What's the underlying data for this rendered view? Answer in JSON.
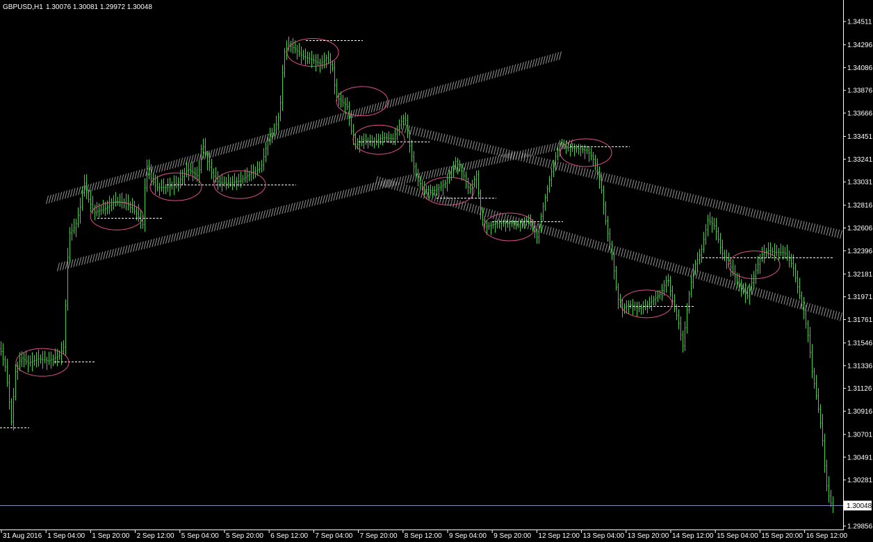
{
  "header": {
    "symbol": "GBPUSD,H1",
    "ohlc": "1.30076 1.30081 1.29972 1.30048"
  },
  "colors": {
    "background": "#000000",
    "candle": "#3fd43f",
    "axis": "#ffffff",
    "channel": "#b0b0b0",
    "ellipse": "#e0508a",
    "dashed_level": "#ffffff",
    "price_line": "#8090c0"
  },
  "chart_data": {
    "type": "line",
    "symbol": "GBPUSD",
    "timeframe": "H1",
    "current_price": "1.30048",
    "ylim": [
      1.29856,
      1.34511
    ],
    "y_ticks": [
      "1.34511",
      "1.34296",
      "1.34086",
      "1.33876",
      "1.33666",
      "1.33451",
      "1.33241",
      "1.33031",
      "1.32816",
      "1.32606",
      "1.32396",
      "1.32181",
      "1.31971",
      "1.31761",
      "1.31546",
      "1.31336",
      "1.31126",
      "1.30916",
      "1.30701",
      "1.30491",
      "1.30281",
      "1.29856"
    ],
    "x_ticks": [
      "31 Aug 2016",
      "1 Sep 04:00",
      "1 Sep 20:00",
      "2 Sep 12:00",
      "5 Sep 04:00",
      "5 Sep 20:00",
      "6 Sep 12:00",
      "7 Sep 04:00",
      "7 Sep 20:00",
      "8 Sep 12:00",
      "9 Sep 04:00",
      "9 Sep 20:00",
      "12 Sep 12:00",
      "13 Sep 04:00",
      "13 Sep 20:00",
      "14 Sep 12:00",
      "15 Sep 04:00",
      "15 Sep 20:00",
      "16 Sep 12:00"
    ],
    "price_path": [
      [
        0,
        1.3149
      ],
      [
        8,
        1.313
      ],
      [
        16,
        1.3082
      ],
      [
        22,
        1.3128
      ],
      [
        30,
        1.3141
      ],
      [
        40,
        1.3136
      ],
      [
        55,
        1.314
      ],
      [
        70,
        1.3138
      ],
      [
        85,
        1.3143
      ],
      [
        92,
        1.3152
      ],
      [
        96,
        1.3226
      ],
      [
        100,
        1.3256
      ],
      [
        108,
        1.3262
      ],
      [
        115,
        1.328
      ],
      [
        120,
        1.3305
      ],
      [
        125,
        1.329
      ],
      [
        135,
        1.3275
      ],
      [
        150,
        1.3278
      ],
      [
        165,
        1.3285
      ],
      [
        180,
        1.3284
      ],
      [
        195,
        1.3275
      ],
      [
        205,
        1.3264
      ],
      [
        210,
        1.332
      ],
      [
        215,
        1.3308
      ],
      [
        225,
        1.3298
      ],
      [
        240,
        1.3298
      ],
      [
        255,
        1.3302
      ],
      [
        270,
        1.3315
      ],
      [
        285,
        1.3308
      ],
      [
        290,
        1.334
      ],
      [
        298,
        1.3322
      ],
      [
        305,
        1.331
      ],
      [
        315,
        1.3302
      ],
      [
        330,
        1.3302
      ],
      [
        345,
        1.3304
      ],
      [
        360,
        1.3311
      ],
      [
        375,
        1.3316
      ],
      [
        385,
        1.3342
      ],
      [
        395,
        1.3352
      ],
      [
        402,
        1.3367
      ],
      [
        408,
        1.3422
      ],
      [
        415,
        1.343
      ],
      [
        425,
        1.3425
      ],
      [
        435,
        1.3419
      ],
      [
        448,
        1.3416
      ],
      [
        460,
        1.3412
      ],
      [
        470,
        1.3418
      ],
      [
        478,
        1.3408
      ],
      [
        483,
        1.3382
      ],
      [
        490,
        1.3378
      ],
      [
        500,
        1.3372
      ],
      [
        505,
        1.335
      ],
      [
        512,
        1.3336
      ],
      [
        520,
        1.3342
      ],
      [
        535,
        1.334
      ],
      [
        550,
        1.3344
      ],
      [
        565,
        1.3343
      ],
      [
        575,
        1.3357
      ],
      [
        582,
        1.3364
      ],
      [
        588,
        1.334
      ],
      [
        594,
        1.332
      ],
      [
        600,
        1.3305
      ],
      [
        610,
        1.3296
      ],
      [
        625,
        1.3295
      ],
      [
        640,
        1.3302
      ],
      [
        655,
        1.3322
      ],
      [
        665,
        1.3312
      ],
      [
        675,
        1.3295
      ],
      [
        685,
        1.331
      ],
      [
        692,
        1.327
      ],
      [
        700,
        1.3262
      ],
      [
        715,
        1.3265
      ],
      [
        730,
        1.3265
      ],
      [
        745,
        1.3264
      ],
      [
        760,
        1.327
      ],
      [
        772,
        1.3252
      ],
      [
        780,
        1.3278
      ],
      [
        790,
        1.3305
      ],
      [
        798,
        1.3325
      ],
      [
        806,
        1.334
      ],
      [
        815,
        1.3335
      ],
      [
        830,
        1.3334
      ],
      [
        845,
        1.3332
      ],
      [
        855,
        1.3322
      ],
      [
        860,
        1.3312
      ],
      [
        866,
        1.3292
      ],
      [
        872,
        1.3262
      ],
      [
        880,
        1.3236
      ],
      [
        888,
        1.3196
      ],
      [
        895,
        1.3186
      ],
      [
        905,
        1.319
      ],
      [
        920,
        1.3186
      ],
      [
        935,
        1.3192
      ],
      [
        950,
        1.32
      ],
      [
        960,
        1.3215
      ],
      [
        968,
        1.319
      ],
      [
        975,
        1.3176
      ],
      [
        982,
        1.3152
      ],
      [
        990,
        1.3196
      ],
      [
        998,
        1.3225
      ],
      [
        1008,
        1.3238
      ],
      [
        1018,
        1.3268
      ],
      [
        1028,
        1.3262
      ],
      [
        1038,
        1.3238
      ],
      [
        1050,
        1.3226
      ],
      [
        1062,
        1.3208
      ],
      [
        1075,
        1.3198
      ],
      [
        1085,
        1.3218
      ],
      [
        1095,
        1.3236
      ],
      [
        1105,
        1.324
      ],
      [
        1115,
        1.3238
      ],
      [
        1128,
        1.3238
      ],
      [
        1140,
        1.3226
      ],
      [
        1150,
        1.3198
      ],
      [
        1158,
        1.3176
      ],
      [
        1163,
        1.3158
      ],
      [
        1168,
        1.3128
      ],
      [
        1175,
        1.3102
      ],
      [
        1182,
        1.3072
      ],
      [
        1188,
        1.3026
      ],
      [
        1193,
        1.301
      ],
      [
        1198,
        1.3002
      ]
    ],
    "channel_lines": [
      {
        "from": [
          68,
          1.32866
        ],
        "to": [
          806,
          1.34196
        ]
      },
      {
        "from": [
          84,
          1.32246
        ],
        "to": [
          536,
          1.32986
        ]
      },
      {
        "from": [
          536,
          1.32986
        ],
        "to": [
          822,
          1.33386
        ]
      },
      {
        "from": [
          580,
          1.33526
        ],
        "to": [
          1210,
          1.32546
        ]
      },
      {
        "from": [
          542,
          1.33046
        ],
        "to": [
          1210,
          1.31786
        ]
      }
    ],
    "dashed_levels": [
      {
        "x1": 0,
        "x2": 42,
        "y": 1.30766
      },
      {
        "x1": 78,
        "x2": 138,
        "y": 1.31376
      },
      {
        "x1": 140,
        "x2": 234,
        "y": 1.32696
      },
      {
        "x1": 240,
        "x2": 426,
        "y": 1.33006
      },
      {
        "x1": 440,
        "x2": 522,
        "y": 1.34336
      },
      {
        "x1": 516,
        "x2": 618,
        "y": 1.33401
      },
      {
        "x1": 628,
        "x2": 714,
        "y": 1.32886
      },
      {
        "x1": 708,
        "x2": 810,
        "y": 1.32666
      },
      {
        "x1": 820,
        "x2": 906,
        "y": 1.33356
      },
      {
        "x1": 905,
        "x2": 1000,
        "y": 1.31886
      },
      {
        "x1": 1010,
        "x2": 1198,
        "y": 1.32336
      },
      {
        "x1": 1090,
        "x2": 1198,
        "y": 1.32336
      }
    ],
    "ellipses": [
      {
        "cx": 61,
        "cy": 1.31366,
        "rx": 38,
        "ry": 20
      },
      {
        "cx": 168,
        "cy": 1.32716,
        "rx": 38,
        "ry": 20
      },
      {
        "cx": 253,
        "cy": 1.32986,
        "rx": 37,
        "ry": 20
      },
      {
        "cx": 345,
        "cy": 1.33006,
        "rx": 37,
        "ry": 20
      },
      {
        "cx": 450,
        "cy": 1.34226,
        "rx": 37,
        "ry": 20
      },
      {
        "cx": 521,
        "cy": 1.33776,
        "rx": 37,
        "ry": 21
      },
      {
        "cx": 545,
        "cy": 1.33421,
        "rx": 37,
        "ry": 21
      },
      {
        "cx": 645,
        "cy": 1.32946,
        "rx": 37,
        "ry": 20
      },
      {
        "cx": 733,
        "cy": 1.32616,
        "rx": 37,
        "ry": 20
      },
      {
        "cx": 843,
        "cy": 1.33301,
        "rx": 37,
        "ry": 20
      },
      {
        "cx": 930,
        "cy": 1.31906,
        "rx": 37,
        "ry": 20
      },
      {
        "cx": 1085,
        "cy": 1.32266,
        "rx": 37,
        "ry": 20
      }
    ]
  }
}
